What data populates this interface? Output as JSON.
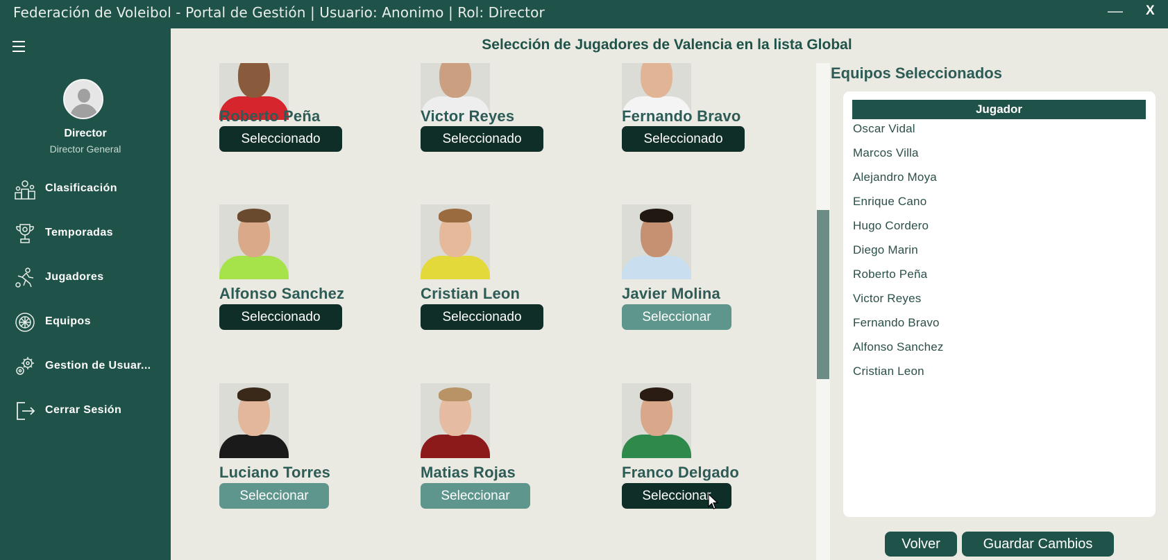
{
  "window": {
    "title": "Federación de Voleibol - Portal de Gestión | Usuario: Anonimo | Rol: Director",
    "minimize_label": "—",
    "close_label": "X"
  },
  "sidebar": {
    "user": {
      "name": "Director",
      "role": "Director General"
    },
    "items": [
      {
        "label": "Clasificación",
        "icon": "podium-icon"
      },
      {
        "label": "Temporadas",
        "icon": "trophy-icon"
      },
      {
        "label": "Jugadores",
        "icon": "player-icon"
      },
      {
        "label": "Equipos",
        "icon": "volleyball-icon"
      },
      {
        "label": "Gestion de Usuar...",
        "icon": "gear-users-icon"
      },
      {
        "label": "Cerrar Sesión",
        "icon": "logout-icon"
      }
    ]
  },
  "main": {
    "title": "Selección de Jugadores de Valencia en la lista Global",
    "players": [
      {
        "name": "Roberto Peña",
        "button": "Seleccionado",
        "selected": true,
        "shirt": "#d7252e",
        "skin": "#8a5a3c",
        "hair": "#1e140f"
      },
      {
        "name": "Victor Reyes",
        "button": "Seleccionado",
        "selected": true,
        "shirt": "#eeeeee",
        "skin": "#caa080",
        "hair": "#3a2a20"
      },
      {
        "name": "Fernando Bravo",
        "button": "Seleccionado",
        "selected": true,
        "shirt": "#f4f4f4",
        "skin": "#e0b495",
        "hair": "#3b2a1f"
      },
      {
        "name": "Alfonso Sanchez",
        "button": "Seleccionado",
        "selected": true,
        "shirt": "#a6e24a",
        "skin": "#d9a98a",
        "hair": "#6a4a2e"
      },
      {
        "name": "Cristian Leon",
        "button": "Seleccionado",
        "selected": true,
        "shirt": "#e3d93a",
        "skin": "#e6b99a",
        "hair": "#9a6b3e"
      },
      {
        "name": "Javier Molina",
        "button": "Seleccionar",
        "selected": false,
        "shirt": "#c9dff0",
        "skin": "#c69072",
        "hair": "#221812"
      },
      {
        "name": "Luciano Torres",
        "button": "Seleccionar",
        "selected": false,
        "shirt": "#1a1a1a",
        "skin": "#e3b79b",
        "hair": "#3a2818"
      },
      {
        "name": "Matias Rojas",
        "button": "Seleccionar",
        "selected": false,
        "shirt": "#8c1a1a",
        "skin": "#e5bca2",
        "hair": "#b89366"
      },
      {
        "name": "Franco Delgado",
        "button": "Seleccionar",
        "selected": false,
        "active": true,
        "shirt": "#2e8a4a",
        "skin": "#d9a88a",
        "hair": "#2a1c12"
      }
    ]
  },
  "right_panel": {
    "title": "Equipos Seleccionados",
    "column_header": "Jugador",
    "rows": [
      "Oscar Vidal",
      "Marcos Villa",
      "Alejandro Moya",
      "Enrique Cano",
      "Hugo Cordero",
      "Diego Marin",
      "Roberto Peña",
      "Victor Reyes",
      "Fernando Bravo",
      "Alfonso Sanchez",
      "Cristian Leon"
    ],
    "back_label": "Volver",
    "save_label": "Guardar Cambios"
  },
  "colors": {
    "sidebar_bg": "#1f5248",
    "content_bg": "#ebeae2",
    "selected_btn": "#0f2e27",
    "select_btn": "#5e968d",
    "heading": "#2d5b56"
  }
}
